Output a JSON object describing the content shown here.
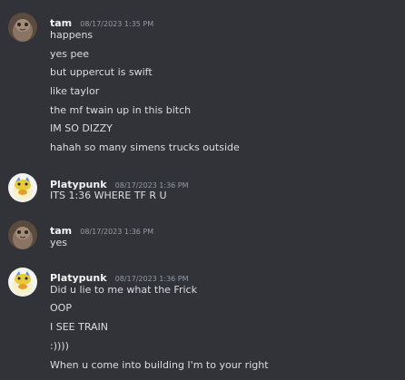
{
  "groups": [
    {
      "username": "tam",
      "timestamp": "08/17/2023 1:35 PM",
      "lines": [
        "happens",
        "yes pee",
        "but uppercut is swift",
        "like taylor",
        "the mf twain up in this bitch",
        "IM SO DIZZY",
        "hahah so many simens trucks outside"
      ]
    },
    {
      "username": "Platypunk",
      "timestamp": "08/17/2023 1:36 PM",
      "lines": [
        "ITS 1:36 WHERE TF R U"
      ]
    },
    {
      "username": "tam",
      "timestamp": "08/17/2023 1:36 PM",
      "lines": [
        "yes"
      ]
    },
    {
      "username": "Platypunk",
      "timestamp": "08/17/2023 1:36 PM",
      "lines": [
        "Did u lie to me what the Frick",
        "OOP",
        "I SEE TRAIN",
        ":))))",
        "When u come into building I'm to your right"
      ]
    }
  ]
}
